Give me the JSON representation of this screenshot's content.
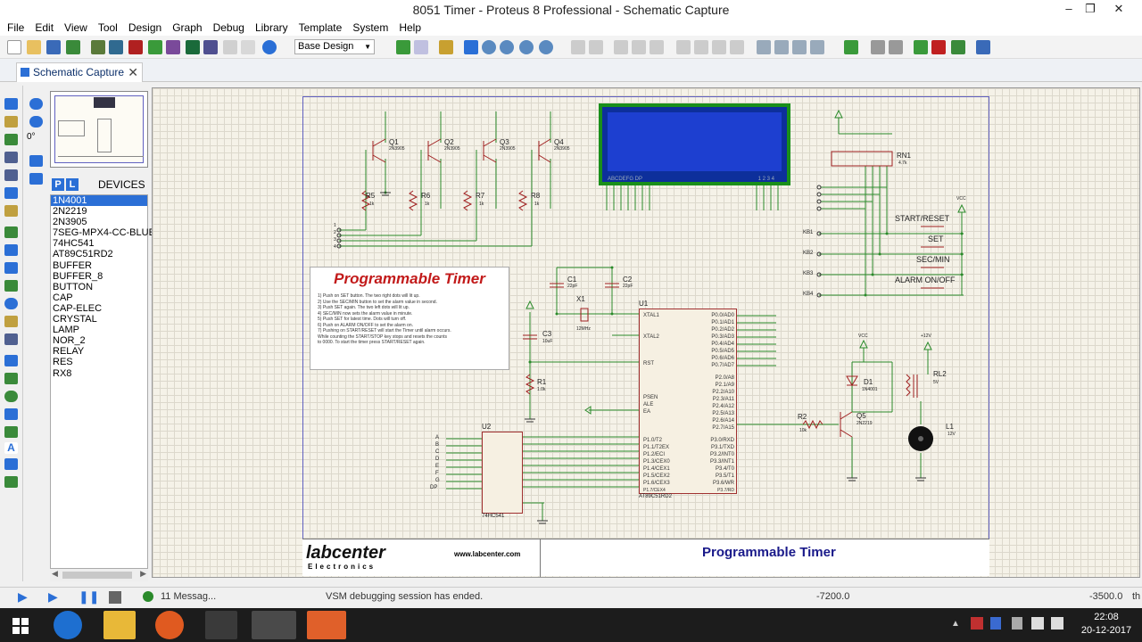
{
  "window": {
    "title": "8051 Timer - Proteus 8 Professional - Schematic Capture",
    "controls": [
      "–",
      "❐",
      "✕"
    ]
  },
  "menu": [
    "File",
    "Edit",
    "View",
    "Tool",
    "Design",
    "Graph",
    "Debug",
    "Library",
    "Template",
    "System",
    "Help"
  ],
  "toolbar": {
    "design_select": "Base Design"
  },
  "tab": {
    "label": "Schematic Capture"
  },
  "left": {
    "rotation": "0°"
  },
  "devices": {
    "p_label": "P",
    "l_label": "L",
    "header": "DEVICES",
    "items": [
      "1N4001",
      "2N2219",
      "2N3905",
      "7SEG-MPX4-CC-BLUE",
      "74HC541",
      "AT89C51RD2",
      "BUFFER",
      "BUFFER_8",
      "BUTTON",
      "CAP",
      "CAP-ELEC",
      "CRYSTAL",
      "LAMP",
      "NOR_2",
      "RELAY",
      "RES",
      "RX8"
    ],
    "selected": 0
  },
  "schematic": {
    "note_title": "Programmable Timer",
    "note_lines": [
      "1) Push on SET button. The two right dots will lit up.",
      "2) Use the SEC/MIN button to set the alarm value in second.",
      "3) Push SET again. The two left dots will lit up.",
      "4) SEC/MIN now sets the alarm value in minute.",
      "5) Push SET for latest time. Dots will turn off.",
      "6) Push on ALARM ON/OFF to set the alarm on.",
      "7) Pushing on START/RESET will start the Timer until alarm occurs.",
      "   While counting the START/STOP key stops and resets the counts",
      "   to 0000. To start the timer press START/RESET again."
    ],
    "transistors": [
      "Q1",
      "Q2",
      "Q3",
      "Q4"
    ],
    "transistor_part": "2N3905",
    "resistors": [
      "R5",
      "R6",
      "R7",
      "R8"
    ],
    "res_value": "1k",
    "caps": [
      "C1",
      "C2",
      "C3"
    ],
    "cap_values": [
      "22pF",
      "22pF",
      "10uF"
    ],
    "crystal": "X1",
    "crystal_val": "12MHz",
    "r1": "R1",
    "r1_val": "1.0k",
    "u1": "U1",
    "u1_part": "AT89C51RD2",
    "u2": "U2",
    "u2_part": "74HC541",
    "rn1": "RN1",
    "rn1_val": "4.7k",
    "buttons": [
      "START/RESET",
      "SET",
      "SEC/MIN",
      "ALARM ON/OFF"
    ],
    "kb": [
      "KB1",
      "KB2",
      "KB3",
      "KB4"
    ],
    "vcc": "VCC",
    "v12": "+12V",
    "d1": "D1",
    "d1_part": "1N4001",
    "rl2": "RL2",
    "rl2_val": "5V",
    "q5": "Q5",
    "q5_part": "2N2219",
    "r2": "R2",
    "r2_val": "10k",
    "l1": "L1",
    "l1_val": "12V",
    "u1_left_pins": [
      "XTAL1",
      "XTAL2",
      "RST",
      "PSEN",
      "ALE",
      "EA"
    ],
    "u1_right_pins": [
      "P0.0/AD0",
      "P0.1/AD1",
      "P0.2/AD2",
      "P0.3/AD3",
      "P0.4/AD4",
      "P0.5/AD5",
      "P0.6/AD6",
      "P0.7/AD7",
      "P2.0/A8",
      "P2.1/A9",
      "P2.2/A10",
      "P2.3/A11",
      "P2.4/A12",
      "P2.5/A13",
      "P2.6/A14",
      "P2.7/A15",
      "P3.0/RXD",
      "P3.1/TXD",
      "P3.2/INT0",
      "P3.3/INT1",
      "P3.4/T0",
      "P3.5/T1",
      "P3.6/WR",
      "P3.7/RD"
    ],
    "u1_p1_pins": [
      "P1.0/T2",
      "P1.1/T2EX",
      "P1.2/ECI",
      "P1.3/CEX0",
      "P1.4/CEX1",
      "P1.5/CEX2",
      "P1.6/CEX3",
      "P1.7/CEX4"
    ],
    "u2_inputs": [
      "A",
      "B",
      "C",
      "D",
      "E",
      "F",
      "G",
      "DP"
    ],
    "lcd_left": "ABCDEFG DP",
    "lcd_right": "1 2 3 4",
    "kb_pins": [
      "1",
      "2",
      "3",
      "4"
    ],
    "lcd_pins": [
      "1",
      "2",
      "3",
      "4"
    ]
  },
  "titleblock": {
    "logo": "labcenter",
    "logo_sub": "Electronics",
    "url": "www.labcenter.com",
    "title": "Programmable Timer"
  },
  "status": {
    "messages": "11 Messag...",
    "text": "VSM debugging session has ended.",
    "x": "-7200.0",
    "y": "-3500.0",
    "unit": "th"
  },
  "clock": {
    "time": "22:08",
    "date": "20-12-2017"
  },
  "colors": {
    "accent": "#2b6fd6",
    "wire": "#2a8a2a",
    "lcd": "#1d3fd0"
  }
}
